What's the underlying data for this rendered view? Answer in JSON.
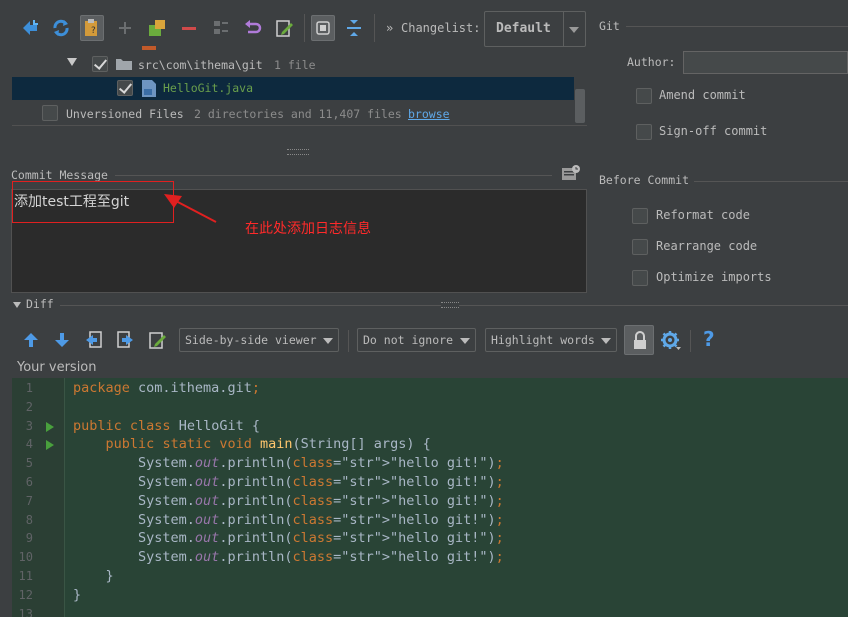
{
  "toolbar": {
    "changelist_label": "Changelist:",
    "changelist_value": "Default",
    "icons": [
      "diff-icon",
      "refresh-icon",
      "group-icon",
      "add-icon",
      "move-icon",
      "remove-icon",
      "list-icon",
      "undo-icon",
      "edit-icon",
      "expand-icon",
      "collapse-icon"
    ]
  },
  "tree": {
    "folder_path": "src\\com\\ithema\\git",
    "folder_count": "1 file",
    "file_name": "HelloGit.java",
    "unversioned_label": "Unversioned Files",
    "unversioned_info": "2 directories and 11,407 files",
    "browse_link": "browse"
  },
  "commit": {
    "label": "Commit Message",
    "message": "添加test工程至git",
    "annotation": "在此处添加日志信息"
  },
  "git_panel": {
    "title": "Git",
    "author_label": "Author:",
    "author_value": "",
    "amend": "Amend commit",
    "signoff": "Sign-off commit"
  },
  "before_commit": {
    "title": "Before Commit",
    "reformat": "Reformat code",
    "rearrange": "Rearrange code",
    "optimize": "Optimize imports"
  },
  "diff": {
    "title": "Diff",
    "viewer": "Side-by-side viewer",
    "ignore": "Do not ignore",
    "highlight": "Highlight words",
    "version_label": "Your version",
    "help": "?"
  },
  "code_lines": [
    {
      "n": "1",
      "text": "package com.ithema.git;"
    },
    {
      "n": "2",
      "text": ""
    },
    {
      "n": "3",
      "text": "public class HelloGit {"
    },
    {
      "n": "4",
      "text": "    public static void main(String[] args) {"
    },
    {
      "n": "5",
      "text": "        System.out.println(\"hello git!\");"
    },
    {
      "n": "6",
      "text": "        System.out.println(\"hello git!\");"
    },
    {
      "n": "7",
      "text": "        System.out.println(\"hello git!\");"
    },
    {
      "n": "8",
      "text": "        System.out.println(\"hello git!\");"
    },
    {
      "n": "9",
      "text": "        System.out.println(\"hello git!\");"
    },
    {
      "n": "10",
      "text": "        System.out.println(\"hello git!\");"
    },
    {
      "n": "11",
      "text": "    }"
    },
    {
      "n": "12",
      "text": "}"
    },
    {
      "n": "13",
      "text": ""
    }
  ],
  "colors": {
    "background": "#3c3f41",
    "selection": "#0d293e",
    "diff_added": "#294436",
    "annotation_red": "#e02020"
  }
}
